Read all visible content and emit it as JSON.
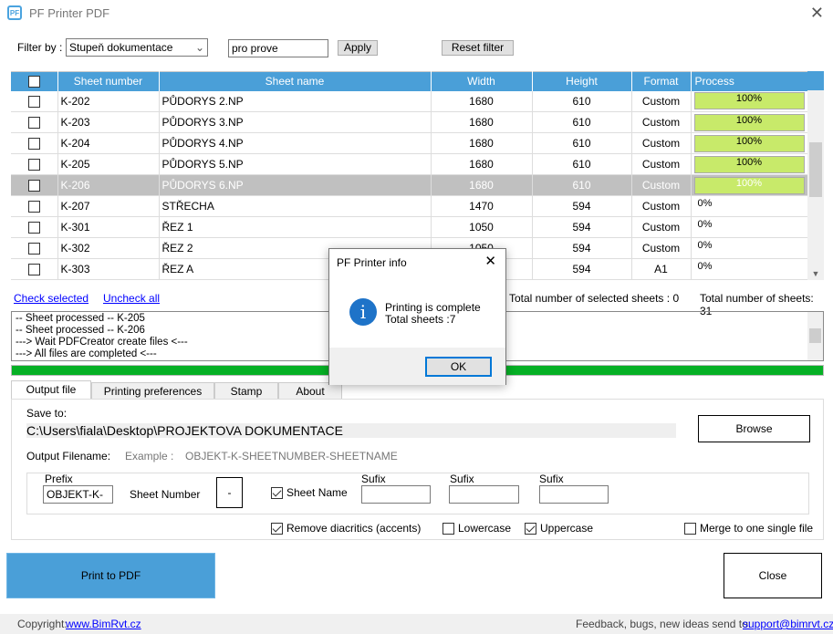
{
  "window": {
    "title": "PF Printer PDF",
    "logo": "PF",
    "close": "✕"
  },
  "filter": {
    "label": "Filter by :",
    "field": "Stupeň dokumentace",
    "value": "pro prove",
    "apply": "Apply",
    "reset": "Reset filter"
  },
  "table": {
    "headers": [
      "Sheet number",
      "Sheet name",
      "Width",
      "Height",
      "Format",
      "Process"
    ],
    "rows": [
      {
        "checked": false,
        "number": "K-202",
        "name": "PŮDORYS 2.NP",
        "width": "1680",
        "height": "610",
        "format": "Custom",
        "process": "100%",
        "progress": 100
      },
      {
        "checked": false,
        "number": "K-203",
        "name": "PŮDORYS 3.NP",
        "width": "1680",
        "height": "610",
        "format": "Custom",
        "process": "100%",
        "progress": 100
      },
      {
        "checked": false,
        "number": "K-204",
        "name": "PŮDORYS 4.NP",
        "width": "1680",
        "height": "610",
        "format": "Custom",
        "process": "100%",
        "progress": 100
      },
      {
        "checked": false,
        "number": "K-205",
        "name": "PŮDORYS 5.NP",
        "width": "1680",
        "height": "610",
        "format": "Custom",
        "process": "100%",
        "progress": 100
      },
      {
        "checked": false,
        "number": "K-206",
        "name": "PŮDORYS 6.NP",
        "width": "1680",
        "height": "610",
        "format": "Custom",
        "process": "100%",
        "progress": 100,
        "selected": true
      },
      {
        "checked": false,
        "number": "K-207",
        "name": "STŘECHA",
        "width": "1470",
        "height": "594",
        "format": "Custom",
        "process": "0%",
        "progress": 0
      },
      {
        "checked": false,
        "number": "K-301",
        "name": "ŘEZ 1",
        "width": "1050",
        "height": "594",
        "format": "Custom",
        "process": "0%",
        "progress": 0
      },
      {
        "checked": false,
        "number": "K-302",
        "name": "ŘEZ 2",
        "width": "1050",
        "height": "594",
        "format": "Custom",
        "process": "0%",
        "progress": 0
      },
      {
        "checked": false,
        "number": "K-303",
        "name": "ŘEZ A",
        "width": "",
        "height": "594",
        "format": "A1",
        "process": "0%",
        "progress": 0
      }
    ]
  },
  "links": {
    "check": "Check selected",
    "uncheck": "Uncheck all"
  },
  "totals": {
    "selected_label": "Total number of selected sheets :",
    "selected": "0",
    "total_label": "Total number of sheets:",
    "total": "31"
  },
  "log": [
    "-- Sheet processed -- K-205",
    "-- Sheet processed -- K-206",
    "---> Wait PDFCreator create files <---",
    "---> All files are completed <---"
  ],
  "progress": 100,
  "tabs": [
    "Output file",
    "Printing preferences",
    "Stamp",
    "About"
  ],
  "output": {
    "save_to": "Save to:",
    "path": "C:\\Users\\fiala\\Desktop\\PROJEKTOVA DOKUMENTACE",
    "browse": "Browse",
    "filename_label": "Output Filename:",
    "example_label": "Example :",
    "example": "OBJEKT-K-SHEETNUMBER-SHEETNAME",
    "prefix_label": "Prefix",
    "prefix": "OBJEKT-K-",
    "sheet_number": "Sheet Number",
    "separator": "-",
    "sheet_name": "Sheet Name",
    "sufix": "Sufix",
    "remove_diacritics": "Remove diacritics (accents)",
    "lowercase": "Lowercase",
    "uppercase": "Uppercase",
    "merge": "Merge to one single file"
  },
  "actions": {
    "print": "Print to PDF",
    "close": "Close"
  },
  "footer": {
    "copyright": "Copyright:",
    "site": "www.BimRvt.cz",
    "feedback": "Feedback, bugs, new ideas send to:",
    "email": "support@bimrvt.cz"
  },
  "dialog": {
    "title": "PF Printer info",
    "line1": "Printing is complete",
    "line2": "Total sheets :7",
    "ok": "OK",
    "icon": "info-icon"
  },
  "colors": {
    "accent": "#4a9fd8",
    "progress": "#06b025",
    "process_bar": "#c8ea6a"
  }
}
